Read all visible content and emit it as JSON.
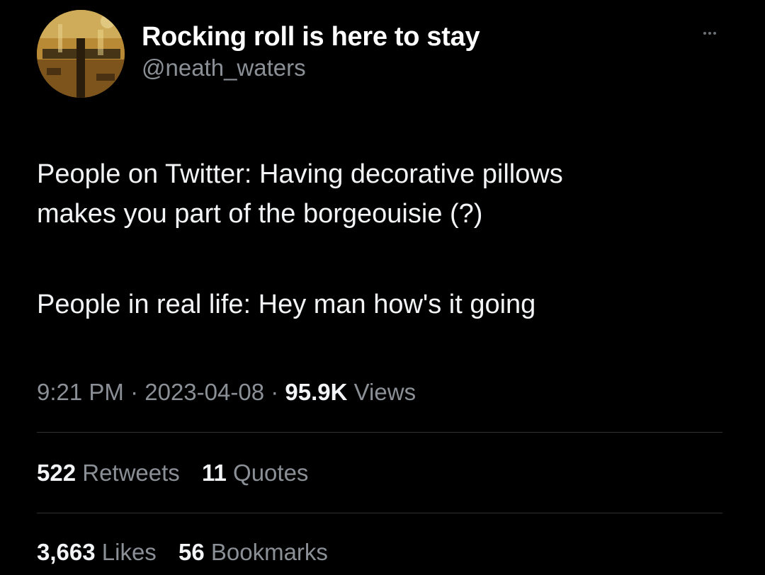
{
  "colors": {
    "background": "#000000",
    "text_primary": "#f2f4f5",
    "text_secondary": "#8b9096",
    "divider": "#2f3336"
  },
  "author": {
    "display_name": "Rocking roll is here to stay",
    "handle": "@neath_waters",
    "avatar_icon": "avatar-photo"
  },
  "more_icon": "ellipsis-icon",
  "tweet": {
    "line1": "People on Twitter: Having decorative pillows",
    "line2": "makes you part of the borgeouisie (?)",
    "line3": "People in real life: Hey man how's it going"
  },
  "meta": {
    "time": "9:21 PM",
    "separator": "·",
    "date": "2023-04-08",
    "views_count": "95.9K",
    "views_label": "Views"
  },
  "stats": {
    "retweets_count": "522",
    "retweets_label": "Retweets",
    "quotes_count": "11",
    "quotes_label": "Quotes",
    "likes_count": "3,663",
    "likes_label": "Likes",
    "bookmarks_count": "56",
    "bookmarks_label": "Bookmarks"
  }
}
